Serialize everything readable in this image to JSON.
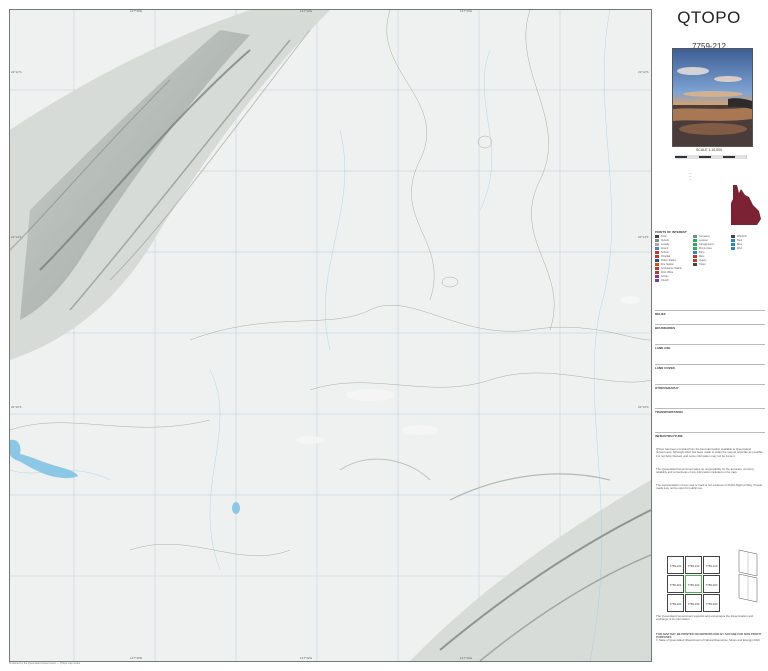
{
  "title": "QTOPO",
  "sheet_number": "7759-212",
  "scale": "SCALE 1:10,000",
  "map": {
    "top_coords": [
      "147°30'E",
      "147°32'E",
      "147°34'E"
    ],
    "bottom_coords": [
      "147°30'E",
      "147°32'E",
      "147°34'E"
    ],
    "left_coords": [
      "22°12'S",
      "22°14'S",
      "22°16'S"
    ],
    "right_coords": [
      "22°12'S",
      "22°14'S",
      "22°16'S"
    ]
  },
  "legend": {
    "sections": [
      {
        "heading": "POINTS OF INTEREST"
      },
      {
        "heading": "RELIEF"
      },
      {
        "heading": "BOUNDARIES"
      },
      {
        "heading": "LAND USE"
      },
      {
        "heading": "LAND COVER"
      },
      {
        "heading": "HYDROGRAPHY"
      },
      {
        "heading": "TRANSPORTATION"
      },
      {
        "heading": "INFRASTRUCTURE"
      }
    ],
    "items": [
      "Town",
      "Suburb",
      "Locality",
      "Airport",
      "School",
      "Hospital",
      "Police Station",
      "Fire Station",
      "Ambulance Station",
      "Post Office",
      "Library",
      "Church",
      "Cemetery",
      "Lookout",
      "Campground",
      "Picnic Area",
      "Dam",
      "Mine",
      "Quarry",
      "Tower",
      "Windmill",
      "Tank",
      "Bore",
      "Well"
    ]
  },
  "colors": {
    "map_base": "#eef1ef",
    "relief_dark": "#9aa19d",
    "water": "#8cc7e6",
    "contour": "#7a7568",
    "grid": "#a8c8df",
    "queensland": "#7b2334"
  },
  "notes": {
    "p1": "QTopo has been compiled from the best information available to Queensland Government. Although effort has been made to make the map as accurate as possible, it is not field checked, and some information may not be current.",
    "p2": "The Queensland Government takes no responsibility for the accuracy, currency, reliability and correctness of any information included on the map.",
    "p3": "The representation of any road or track is not evidence of Public Right of Way. Private roads may not be open for public use.",
    "p4": "The Queensland Government supports and encourages the dissemination and exchange of its information.",
    "p5": "THIS MAP MAY BE PRINTED OR REPRODUCED BY ANYONE FOR NON PROFIT PURPOSES",
    "copyright": "© State of Queensland (Department of Natural Resources, Mines and Energy) 2020"
  },
  "index": {
    "cells": [
      "7759-211",
      "7759-212",
      "7759-213",
      "7759-221",
      "7759-222",
      "7759-223",
      "7759-231",
      "7759-232",
      "7759-233"
    ],
    "label": "INDEX TO ADJOINING MAPS"
  },
  "footer": "Produced by the Queensland Government — QTopo map series"
}
